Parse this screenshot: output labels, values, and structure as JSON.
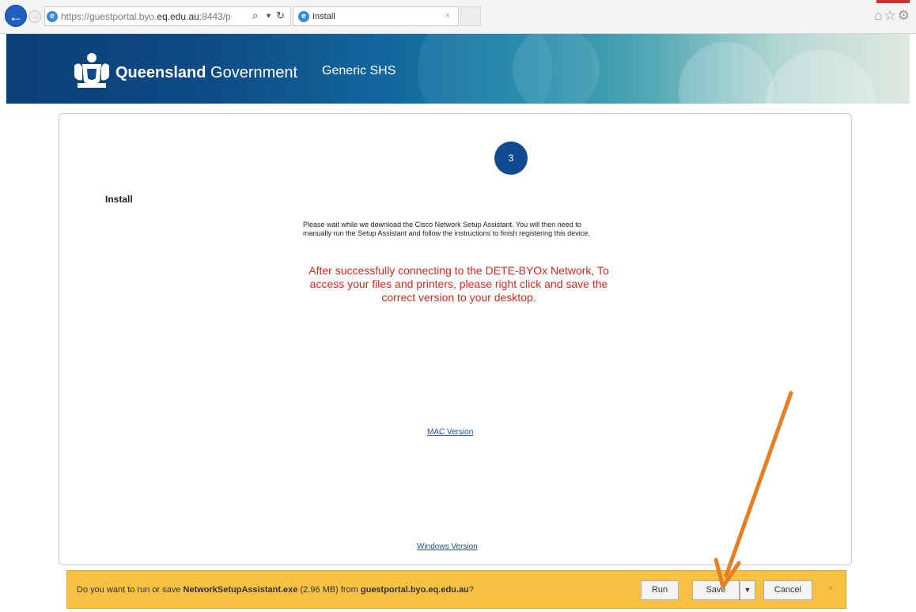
{
  "browser": {
    "url_prefix": "https://guestportal.byo.",
    "url_domain": "eq.edu.au",
    "url_suffix": ":8443/p ",
    "tab_title": "Install",
    "tab_close": "×",
    "back_icon": "←",
    "forward_icon": "→",
    "search_icon": "⌕",
    "dropdown_icon": "▾",
    "refresh_icon": "↻",
    "toolbar_icons": "⌂☆⚙"
  },
  "banner": {
    "brand_bold": "Queensland",
    "brand_regular": " Government",
    "site_name": "Generic SHS"
  },
  "page": {
    "step_number": "3",
    "section_title": "Install",
    "instructions": "Please wait while we download the Cisco Network Setup Assistant. You will then need to manually run the Setup Assistant and follow the instructions to finish registering this device.",
    "notice": "After successfully connecting to the DETE-BYOx Network, To access your files and printers, please right click and save the correct version to your desktop.",
    "mac_link": "MAC Version",
    "windows_link": "Windows Version"
  },
  "download_bar": {
    "msg_prefix": "Do you want to run or save ",
    "filename": "NetworkSetupAssistant.exe",
    "size": " (2.96 MB) from ",
    "source": "guestportal.byo.eq.edu.au",
    "msg_suffix": "?",
    "run_label": "Run",
    "save_label": "Save",
    "save_options_icon": "▼",
    "cancel_label": "Cancel",
    "close_icon": "×"
  },
  "colors": {
    "accent_blue": "#124a92",
    "notice_red": "#d42a1f",
    "bar_yellow": "#f7c243",
    "annotation_orange": "#e67e22"
  }
}
